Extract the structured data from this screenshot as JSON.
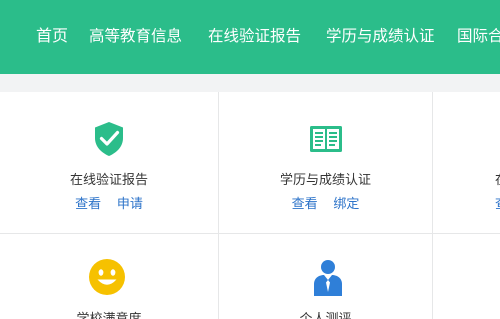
{
  "nav": {
    "items": [
      {
        "label": "首页"
      },
      {
        "label": "高等教育信息"
      },
      {
        "label": "在线验证报告"
      },
      {
        "label": "学历与成绩认证"
      },
      {
        "label": "国际合"
      }
    ]
  },
  "services": [
    {
      "title": "在线验证报告",
      "icon": "shield-check-icon",
      "links": [
        "查看",
        "申请"
      ]
    },
    {
      "title": "学历与成绩认证",
      "icon": "certificate-book-icon",
      "links": [
        "查看",
        "绑定"
      ]
    },
    {
      "title": "学校满意度",
      "icon": "smiley-face-icon"
    },
    {
      "title": "个人测评",
      "icon": "person-tie-icon"
    }
  ],
  "edge": {
    "title_glyph": "在",
    "link_glyph": "查"
  },
  "colors": {
    "brand_green": "#2bbd8a",
    "link_blue": "#2c73c9",
    "smiley_yellow": "#f6c100",
    "person_blue": "#2f7fd8"
  }
}
